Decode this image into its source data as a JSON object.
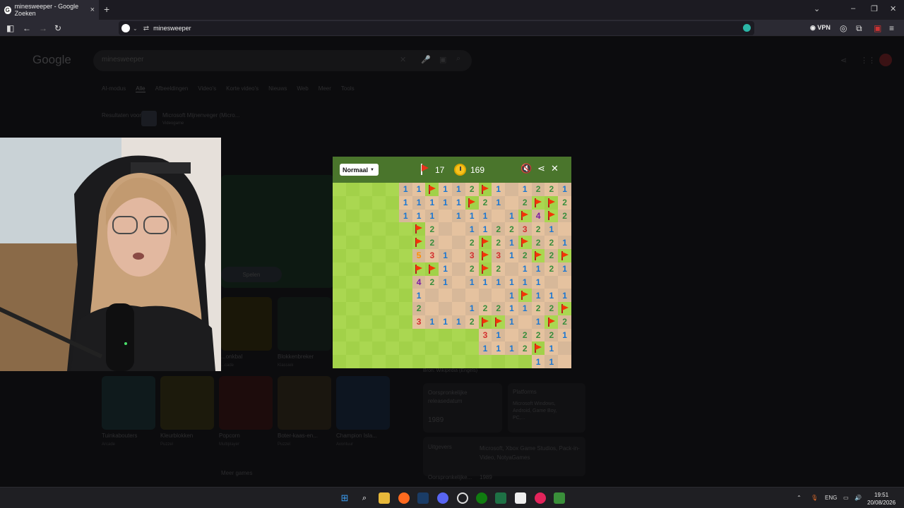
{
  "browser": {
    "tab_title": "minesweeper - Google Zoeken",
    "tab_close": "×",
    "new_tab": "+",
    "url": "minesweeper",
    "vpn_label": "VPN",
    "favicon_letter": "G"
  },
  "google": {
    "logo": "Google",
    "search_value": "minesweeper",
    "tabs": [
      "AI-modus",
      "Alle",
      "Afbeeldingen",
      "Video's",
      "Korte video's",
      "Nieuws",
      "Web",
      "Meer",
      "Tools"
    ],
    "results_for": "Resultaten voor",
    "app_name": "Microsoft Mijnenveger (Micro...",
    "app_sub": "Videogame",
    "play_button": "Spelen",
    "game_thumbs": [
      {
        "title": "Tuinkabouters",
        "sub": "Arcade"
      },
      {
        "title": "Kleurblokken",
        "sub": "Puzzel"
      },
      {
        "title": "Popcorn",
        "sub": "Multiplayer"
      },
      {
        "title": "Boter-kaas-en...",
        "sub": "Puzzel"
      },
      {
        "title": "Champion Isla...",
        "sub": "Avontuur"
      }
    ],
    "side_thumbs": [
      {
        "title": "...onkbal",
        "sub": "...cade"
      },
      {
        "title": "Blokkenbreker",
        "sub": "Klassiek"
      }
    ],
    "more_games": "Meer games",
    "source": "Bron: Wikipedia (Engels)",
    "release_label": "Oorspronkelijke releasedatum",
    "release_value": "1989",
    "platforms_label": "Platforms",
    "platforms_value": "Microsoft Windows, Android, Game Boy, PC,...",
    "publishers_label": "Uitgevers",
    "publishers_value": "Microsoft, Xbox Game Studios, Pack-in-Video, NotyaGames",
    "release_label2": "Oorspronkelijke...",
    "release_value2": "1989"
  },
  "game": {
    "difficulty": "Normaal",
    "flags_left": "17",
    "time": "169",
    "board_rows": [
      "UUUUU11F112F1.1221",
      "UUUUU11111F21.2FF2",
      "UUUUU111.111.1F4F2",
      "UUUUUUF2..1122321.",
      "UUUUUUF2..2F21F221",
      "UUUUUU531.3F312F2F",
      "UUUUUUFF1.2F2.1121",
      "UUUUUU421.111111..",
      "UUUUUU1......1F111",
      "UUUUUU2...1221122F",
      "UUUUUU31112FF1.1F2",
      "UUUUUUUUUUU31.2221",
      "UUUUUUUUUUU1112F1.",
      "UUUUUUUUUUUUUUU11."
    ],
    "colors": {
      "header": "#4a752c",
      "flag": "#f23607"
    }
  },
  "taskbar": {
    "language": "ENG",
    "time": "19:51",
    "date": "20/08/2026"
  }
}
